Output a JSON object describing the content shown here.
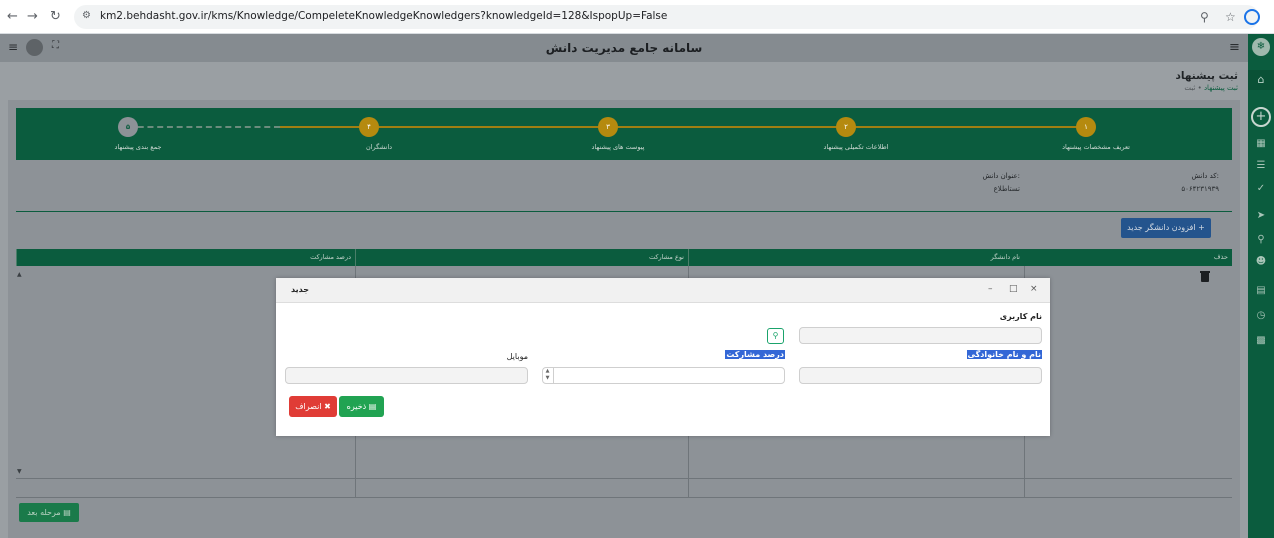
{
  "browser": {
    "url": "km2.behdasht.gov.ir/kms/Knowledge/CompeleteKnowledgeKnowledgers?knowledgeId=128&IspopUp=False",
    "back_icon": "arrow-left-icon",
    "forward_icon": "arrow-right-icon",
    "reload_icon": "reload-icon"
  },
  "header": {
    "title": "سامانه جامع مدیریت دانش"
  },
  "page": {
    "title": "ثبت پیشنهاد",
    "breadcrumb_home": "ثبت",
    "breadcrumb_sep": "•",
    "breadcrumb_current": "ثبت پیشنهاد"
  },
  "stepper": {
    "steps": [
      {
        "number": "۱",
        "label": "تعریف مشخصات پیشنهاد"
      },
      {
        "number": "۲",
        "label": "اطلاعات تکمیلی پیشنهاد"
      },
      {
        "number": "۳",
        "label": "پیوست های پیشنهاد"
      },
      {
        "number": "۴",
        "label": "دانشگران"
      },
      {
        "number": "۵",
        "label": "جمع بندی پیشنهاد"
      }
    ]
  },
  "info": {
    "code_label": "کد دانش:",
    "code_value": "۵۰۶۴۲۳۱۹۳۹",
    "subject_label": "عنوان دانش:",
    "subject_value": "تستاطلاع"
  },
  "actions": {
    "add_label": "افزودن دانشگر جدید +",
    "next_label": "مرحله بعد"
  },
  "table": {
    "headers": [
      "حذف",
      "نام دانشگر",
      "نوع مشارکت",
      "درصد مشارکت"
    ]
  },
  "modal": {
    "title": "جدید",
    "minimize": "–",
    "maximize": "□",
    "close": "×",
    "username_label": "نام کاربری",
    "username_value": "",
    "fullname_label": "نام و نام خانوادگی",
    "fullname_value": "",
    "percent_label": "درصد مشارکت",
    "percent_value": "",
    "mobile_label": "موبایل",
    "mobile_value": "",
    "save_label": "ذخیره",
    "cancel_label": "انصراف"
  },
  "colors": {
    "primary_green": "#0b5c3e",
    "step_done": "#b58a0f",
    "add_button": "#24548d",
    "save_button": "#21a352",
    "cancel_button": "#e03c36",
    "highlight": "#3367d6"
  }
}
